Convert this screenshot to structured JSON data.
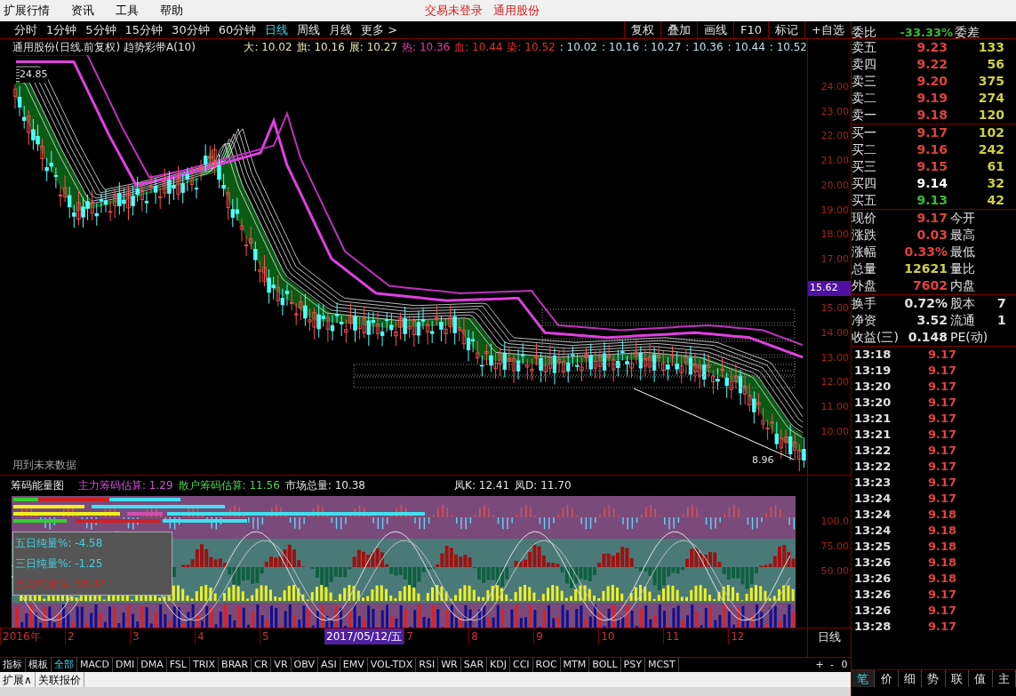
{
  "menu": [
    "扩展行情",
    "资讯",
    "工具",
    "帮助"
  ],
  "notices": [
    "交易未登录",
    "通用股份"
  ],
  "periods": [
    {
      "label": "分时",
      "selected": false
    },
    {
      "label": "1分钟",
      "selected": false
    },
    {
      "label": "5分钟",
      "selected": false
    },
    {
      "label": "15分钟",
      "selected": false
    },
    {
      "label": "30分钟",
      "selected": false
    },
    {
      "label": "60分钟",
      "selected": false
    },
    {
      "label": "日线",
      "selected": true
    },
    {
      "label": "周线",
      "selected": false
    },
    {
      "label": "月线",
      "selected": false
    },
    {
      "label": "更多 >",
      "selected": false
    }
  ],
  "tools": [
    "复权",
    "叠加",
    "画线",
    "F10",
    "标记",
    "+自选"
  ],
  "chart": {
    "title": "通用股份(日线.前复权) 趋势彩带A(10)",
    "legend": [
      {
        "label": "大:",
        "value": "10.02",
        "color": "#e8e0b0"
      },
      {
        "label": "旗:",
        "value": "10.16",
        "color": "#e8e0b0"
      },
      {
        "label": "展:",
        "value": "10.27",
        "color": "#e8e0b0"
      },
      {
        "label": "热:",
        "value": "10.36",
        "color": "#e040a0"
      },
      {
        "label": "血:",
        "value": "10.44",
        "color": "#e03030"
      },
      {
        "label": "染:",
        "value": "10.52",
        "color": "#e03030"
      }
    ],
    "tail_values": [
      ": 10.02",
      ": 10.16",
      ": 10.27",
      ": 10.36",
      ": 10.44",
      ": 10.52"
    ],
    "high_label": "24.85",
    "low_label": "8.96",
    "note": "用到未来数据",
    "y_axis_upper": [
      "24.00",
      "23.00",
      "22.00",
      "21.00",
      "20.00",
      "19.00",
      "18.00",
      "17.00"
    ],
    "y_axis_lower": [
      "15.00",
      "14.00",
      "13.00",
      "12.00",
      "11.00",
      "10.00"
    ],
    "current_price": "15.62"
  },
  "indicator": {
    "title": "筹码能量图",
    "stats": [
      {
        "label": "主力筹码估算:",
        "value": "1.29",
        "color": "#d050d0"
      },
      {
        "label": "散户筹码估算:",
        "value": "11.56",
        "color": "#50d050"
      },
      {
        "label": "市场总量:",
        "value": "10.38",
        "color": "#e0e0e0"
      }
    ],
    "kd": [
      {
        "label": "凤K",
        "value": ": 12.41"
      },
      {
        "label": "凤D",
        "value": ": 11.70"
      }
    ],
    "panel": [
      {
        "label": "五日纯量%:",
        "value": "-4.58",
        "color": "#40d0e0"
      },
      {
        "label": "三日纯量%:",
        "value": "-1.25",
        "color": "#40d0e0"
      },
      {
        "label": "当日纯量%:",
        "value": "33.47",
        "color": "#d02020"
      }
    ],
    "y_axis": [
      "100.0",
      "75.00",
      "50.00"
    ]
  },
  "dates": [
    {
      "label": "2016年",
      "selected": false
    },
    {
      "label": "2",
      "selected": false
    },
    {
      "label": "3",
      "selected": false
    },
    {
      "label": "4",
      "selected": false
    },
    {
      "label": "5",
      "selected": false
    },
    {
      "label": "2017/05/12/五",
      "selected": true
    },
    {
      "label": "7",
      "selected": false
    },
    {
      "label": "8",
      "selected": false
    },
    {
      "label": "9",
      "selected": false
    },
    {
      "label": "10",
      "selected": false
    },
    {
      "label": "11",
      "selected": false
    },
    {
      "label": "12",
      "selected": false
    }
  ],
  "period_label": "日线",
  "indicator_tabs": [
    {
      "label": "指标",
      "selected": false
    },
    {
      "label": "模板",
      "selected": false
    },
    {
      "label": "全部",
      "selected": true
    },
    {
      "label": "MACD",
      "selected": false
    },
    {
      "label": "DMI",
      "selected": false
    },
    {
      "label": "DMA",
      "selected": false
    },
    {
      "label": "FSL",
      "selected": false
    },
    {
      "label": "TRIX",
      "selected": false
    },
    {
      "label": "BRAR",
      "selected": false
    },
    {
      "label": "CR",
      "selected": false
    },
    {
      "label": "VR",
      "selected": false
    },
    {
      "label": "OBV",
      "selected": false
    },
    {
      "label": "ASI",
      "selected": false
    },
    {
      "label": "EMV",
      "selected": false
    },
    {
      "label": "VOL-TDX",
      "selected": false
    },
    {
      "label": "RSI",
      "selected": false
    },
    {
      "label": "WR",
      "selected": false
    },
    {
      "label": "SAR",
      "selected": false
    },
    {
      "label": "KDJ",
      "selected": false
    },
    {
      "label": "CCI",
      "selected": false
    },
    {
      "label": "ROC",
      "selected": false
    },
    {
      "label": "MTM",
      "selected": false
    },
    {
      "label": "BOLL",
      "selected": false
    },
    {
      "label": "PSY",
      "selected": false
    },
    {
      "label": "MCST",
      "selected": false
    }
  ],
  "zoom_buttons": [
    "+",
    "-",
    "0"
  ],
  "bottom_tabs": [
    "扩展∧",
    "关联报价"
  ],
  "quote": {
    "ratio": {
      "label": "委比",
      "value": "-33.33%",
      "label2": "委差"
    },
    "asks": [
      {
        "label": "卖五",
        "price": "9.23",
        "volume": "133",
        "color": "#e04040"
      },
      {
        "label": "卖四",
        "price": "9.22",
        "volume": "56",
        "color": "#e04040"
      },
      {
        "label": "卖三",
        "price": "9.20",
        "volume": "375",
        "color": "#e04040"
      },
      {
        "label": "卖二",
        "price": "9.19",
        "volume": "274",
        "color": "#e04040"
      },
      {
        "label": "卖一",
        "price": "9.18",
        "volume": "120",
        "color": "#e04040"
      }
    ],
    "bids": [
      {
        "label": "买一",
        "price": "9.17",
        "volume": "102",
        "color": "#e04040"
      },
      {
        "label": "买二",
        "price": "9.16",
        "volume": "242",
        "color": "#e04040"
      },
      {
        "label": "买三",
        "price": "9.15",
        "volume": "61",
        "color": "#e04040"
      },
      {
        "label": "买四",
        "price": "9.14",
        "volume": "32",
        "color": "#ffffff"
      },
      {
        "label": "买五",
        "price": "9.13",
        "volume": "42",
        "color": "#30c030"
      }
    ],
    "summary": [
      {
        "label": "现价",
        "value": "9.17",
        "label2": "今开",
        "color": "#e04040"
      },
      {
        "label": "涨跌",
        "value": "0.03",
        "label2": "最高",
        "color": "#e04040"
      },
      {
        "label": "涨幅",
        "value": "0.33%",
        "label2": "最低",
        "color": "#e04040"
      },
      {
        "label": "总量",
        "value": "12621",
        "label2": "量比",
        "color": "#d0d040"
      },
      {
        "label": "外盘",
        "value": "7602",
        "label2": "内盘",
        "color": "#e04040"
      }
    ],
    "finance": [
      {
        "label": "换手",
        "value": "0.72%",
        "label2": "股本",
        "extra": "7"
      },
      {
        "label": "净资",
        "value": "3.52",
        "label2": "流通",
        "extra": "1"
      },
      {
        "label": "收益(三)",
        "value": "0.148",
        "label2": "PE(动)"
      }
    ],
    "ticks": [
      {
        "time": "13:18",
        "price": "9.17"
      },
      {
        "time": "13:19",
        "price": "9.17"
      },
      {
        "time": "13:20",
        "price": "9.17"
      },
      {
        "time": "13:20",
        "price": "9.17"
      },
      {
        "time": "13:21",
        "price": "9.17"
      },
      {
        "time": "13:21",
        "price": "9.17"
      },
      {
        "time": "13:22",
        "price": "9.17"
      },
      {
        "time": "13:22",
        "price": "9.17"
      },
      {
        "time": "13:23",
        "price": "9.17"
      },
      {
        "time": "13:24",
        "price": "9.17"
      },
      {
        "time": "13:24",
        "price": "9.18"
      },
      {
        "time": "13:24",
        "price": "9.18"
      },
      {
        "time": "13:25",
        "price": "9.18"
      },
      {
        "time": "13:26",
        "price": "9.18"
      },
      {
        "time": "13:26",
        "price": "9.18"
      },
      {
        "time": "13:26",
        "price": "9.17"
      },
      {
        "time": "13:26",
        "price": "9.17"
      },
      {
        "time": "13:28",
        "price": "9.17"
      }
    ],
    "tabs": [
      {
        "label": "笔",
        "selected": true
      },
      {
        "label": "价",
        "selected": false
      },
      {
        "label": "细",
        "selected": false
      },
      {
        "label": "势",
        "selected": false
      },
      {
        "label": "联",
        "selected": false
      },
      {
        "label": "值",
        "selected": false
      },
      {
        "label": "主",
        "selected": false
      }
    ]
  }
}
